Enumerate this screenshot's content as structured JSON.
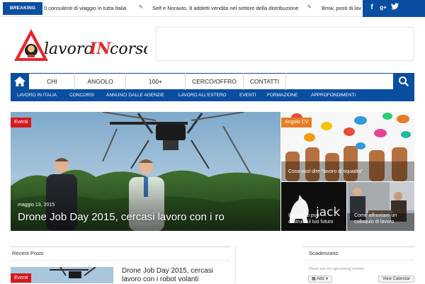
{
  "topbar": {
    "breaking_label": "BREAKING NEWS",
    "items": [
      "0 consulenti di viaggio in tutta Italia",
      "Self e Norauto, 8 addetti vendita nel settore della distribuzione",
      "Bmw, posti di lavo"
    ],
    "social": [
      "f",
      "g+",
      "twitter"
    ]
  },
  "logo": {
    "part1": "lavoro",
    "part2": "IN",
    "part3": "corso"
  },
  "nav": {
    "items": [
      "CHI",
      "ANGOLO",
      "100+",
      "CERCO/OFFRO",
      "CONTATTI"
    ]
  },
  "subnav": {
    "items": [
      "LAVORO IN ITALIA",
      "CONCORSI",
      "ANNUNCI DALLE AGENZIE",
      "LAVORO ALL'ESTERO",
      "EVENTI",
      "FORMAZIONE",
      "APPROFONDIMENTI"
    ]
  },
  "slider": {
    "main": {
      "tag": "Eventi",
      "date": "maggio 13, 2015",
      "title": "Drone Job Day 2015, cercasi lavoro con i ro"
    },
    "tiles": [
      {
        "tag": "Angolo CV",
        "caption": "Cosa vuol dire \"lavoro di squadra\""
      },
      {
        "caption": "Il passato può costruire il tuo futuro",
        "overlay": "jack"
      },
      {
        "caption": "Come affrontare un colloquio di lavoro"
      }
    ]
  },
  "recent": {
    "heading": "Recent Posts",
    "tag": "Eventi",
    "post_title": "Drone Job Day 2015, cercasi lavoro con i robot volanti"
  },
  "calendar": {
    "heading": "Scadenzario",
    "empty": "There are no upcoming events.",
    "add_label": "Add",
    "view_label": "View Calendar"
  },
  "colors": {
    "brand_blue": "#0a4ea1",
    "tag_red": "#d6191e"
  }
}
